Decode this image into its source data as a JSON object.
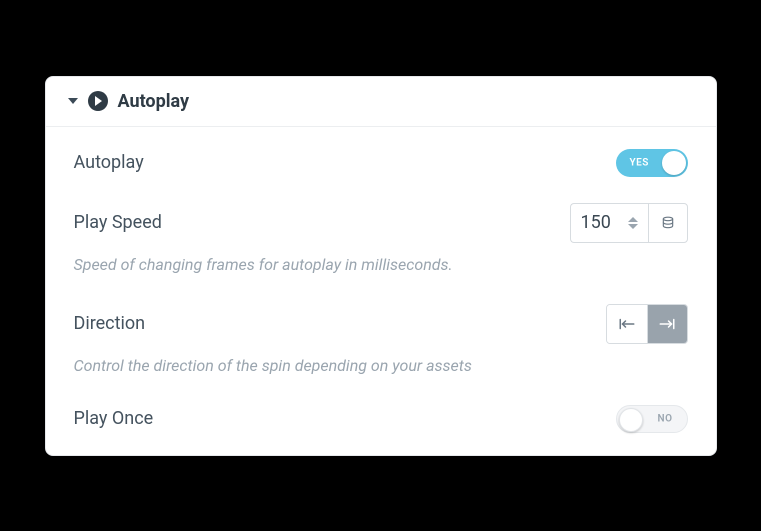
{
  "section": {
    "title": "Autoplay"
  },
  "fields": {
    "autoplay": {
      "label": "Autoplay",
      "toggle_on_text": "YES",
      "toggle_off_text": "NO",
      "value": true
    },
    "play_speed": {
      "label": "Play Speed",
      "value": "150",
      "help": "Speed of changing frames for autoplay in milliseconds."
    },
    "direction": {
      "label": "Direction",
      "help": "Control the direction of the spin depending on your assets",
      "selected": "right"
    },
    "play_once": {
      "label": "Play Once",
      "toggle_on_text": "YES",
      "toggle_off_text": "NO",
      "value": false
    }
  }
}
